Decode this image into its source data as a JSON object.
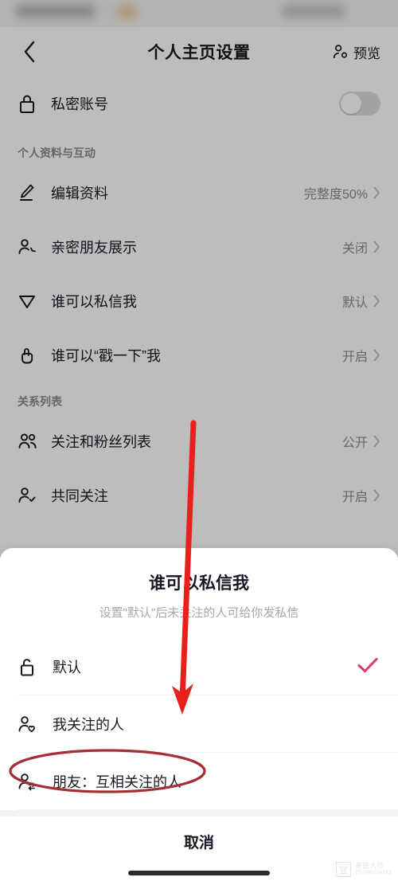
{
  "header": {
    "back_icon": "chevron-left-icon",
    "title": "个人主页设置",
    "preview_icon": "person-icon",
    "preview_label": "预览"
  },
  "private_account": {
    "icon": "lock-icon",
    "label": "私密账号",
    "toggle_state": "off"
  },
  "sections": [
    {
      "heading": "个人资料与互动",
      "rows": [
        {
          "icon": "pencil-icon",
          "label": "编辑资料",
          "value": "完整度50%",
          "chevron": "›"
        },
        {
          "icon": "person-add-icon",
          "label": "亲密朋友展示",
          "value": "关闭",
          "chevron": "›"
        },
        {
          "icon": "paper-plane-icon",
          "label": "谁可以私信我",
          "value": "默认",
          "chevron": "›"
        },
        {
          "icon": "hand-tap-icon",
          "label": "谁可以“戳一下”我",
          "value": "开启",
          "chevron": "›"
        }
      ]
    },
    {
      "heading": "关系列表",
      "rows": [
        {
          "icon": "people-icon",
          "label": "关注和粉丝列表",
          "value": "公开",
          "chevron": "›"
        },
        {
          "icon": "person-check-icon",
          "label": "共同关注",
          "value": "开启",
          "chevron": "›"
        }
      ]
    }
  ],
  "sheet": {
    "title": "谁可以私信我",
    "subtitle": "设置\"默认\"后未关注的人可给你发私信",
    "options": [
      {
        "icon": "unlock-icon",
        "label": "默认",
        "selected": true,
        "check_icon": "check-icon"
      },
      {
        "icon": "person-heart-icon",
        "label": "我关注的人",
        "selected": false,
        "check_icon": ""
      },
      {
        "icon": "person-exchange-icon",
        "label": "朋友：互相关注的人",
        "selected": false,
        "check_icon": ""
      }
    ],
    "cancel_label": "取消"
  },
  "annotations": {
    "arrow_color": "#E8201C",
    "ellipse_color": "#A32E35",
    "arrow_target": "朋友：互相关注的人"
  },
  "colors": {
    "accent_check": "#D93A6E",
    "text_primary": "#161823",
    "text_secondary": "#8a8b91",
    "sheet_background": "#ffffff",
    "divider": "#f4f4f6"
  },
  "watermark": {
    "logo_glyph": "宜",
    "name": "美篇大师",
    "id": "ID:68666043"
  }
}
